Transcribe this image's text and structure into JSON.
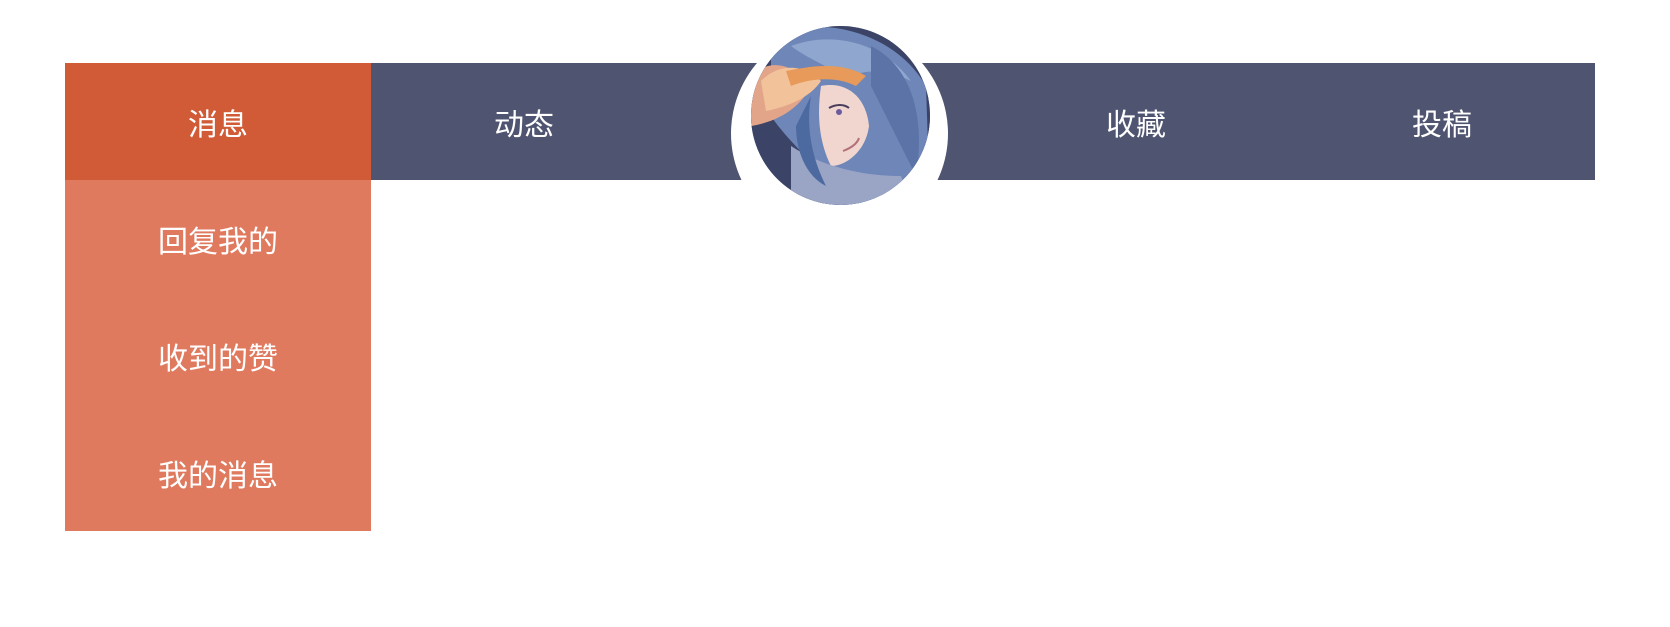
{
  "nav": {
    "items": [
      {
        "label": "消息",
        "active": true
      },
      {
        "label": "动态",
        "active": false
      },
      {
        "label": "收藏",
        "active": false
      },
      {
        "label": "投稿",
        "active": false
      }
    ]
  },
  "dropdown": {
    "items": [
      {
        "label": "回复我的"
      },
      {
        "label": "收到的赞"
      },
      {
        "label": "我的消息"
      }
    ]
  },
  "colors": {
    "nav_bg": "#4f5470",
    "active_bg": "#d15b36",
    "dropdown_bg": "#e07a5f",
    "text": "#ffffff"
  },
  "avatar": {
    "icon": "user-avatar"
  }
}
